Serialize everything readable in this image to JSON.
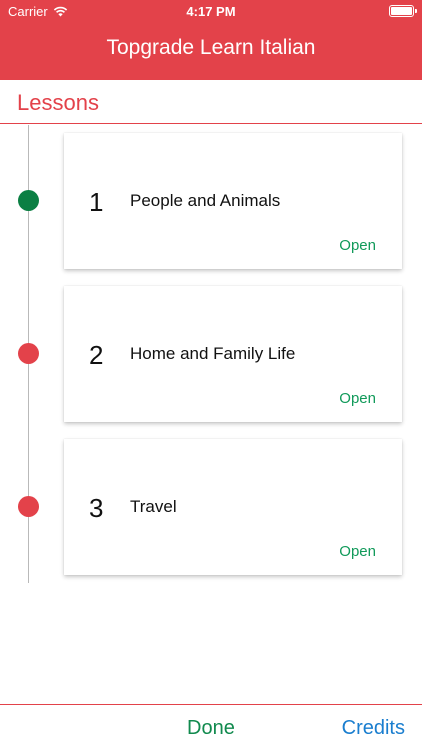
{
  "status_bar": {
    "carrier": "Carrier",
    "time": "4:17 PM"
  },
  "app": {
    "title": "Topgrade Learn Italian"
  },
  "section": {
    "title": "Lessons"
  },
  "lessons": [
    {
      "number": "1",
      "name": "People and Animals",
      "action": "Open",
      "dot_color": "#0b7f43"
    },
    {
      "number": "2",
      "name": "Home and Family Life",
      "action": "Open",
      "dot_color": "#e3424a"
    },
    {
      "number": "3",
      "name": "Travel",
      "action": "Open",
      "dot_color": "#e3424a"
    }
  ],
  "footer": {
    "done_label": "Done",
    "credits_label": "Credits"
  },
  "colors": {
    "accent": "#e3424a",
    "open": "#119a5a",
    "done": "#118a4e",
    "credits": "#1a7ecf"
  }
}
